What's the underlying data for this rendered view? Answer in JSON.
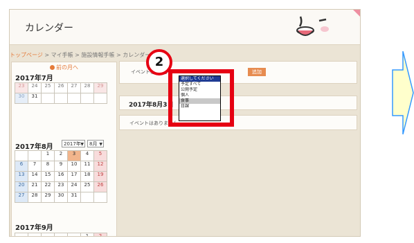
{
  "page": {
    "title": "カレンダー"
  },
  "breadcrumb": {
    "home": "トップページ",
    "rest": " > マイ手帳 > 施設情報手帳 > カレンダー"
  },
  "calendar": {
    "prev_label": "前の月へ",
    "july": {
      "heading": "2017年7月",
      "rows": [
        [
          "23",
          "24",
          "25",
          "26",
          "27",
          "28",
          "29"
        ],
        [
          "30",
          "31",
          "",
          "",
          "",
          "",
          ""
        ]
      ]
    },
    "august": {
      "heading": "2017年8月",
      "year_select": "2017年",
      "month_select": "8月",
      "rows": [
        [
          "",
          "",
          "1",
          "2",
          "3",
          "4",
          "5"
        ],
        [
          "6",
          "7",
          "8",
          "9",
          "10",
          "11",
          "12"
        ],
        [
          "13",
          "14",
          "15",
          "16",
          "17",
          "18",
          "19"
        ],
        [
          "20",
          "21",
          "22",
          "23",
          "24",
          "25",
          "26"
        ],
        [
          "27",
          "28",
          "29",
          "30",
          "31",
          "",
          ""
        ]
      ]
    },
    "september": {
      "heading": "2017年9月",
      "rows": [
        [
          "",
          "",
          "",
          "",
          "",
          "1",
          "2"
        ]
      ]
    }
  },
  "events": {
    "type_label": "イベント種別選択",
    "add_button": "追加",
    "date_heading": "2017年8月3日",
    "empty_text": "イベントはありません"
  },
  "dropdown": {
    "options": [
      "選択してください",
      "予定すべて",
      "公開予定",
      "個人",
      "食事",
      "日課"
    ],
    "selected_index": 0,
    "highlight_index": 4
  },
  "step": {
    "number": "2"
  },
  "colors": {
    "highlight": "#e60012",
    "arrow_fill": "#ffffcc",
    "arrow_stroke": "#3399ff",
    "accent": "#e78c50"
  }
}
